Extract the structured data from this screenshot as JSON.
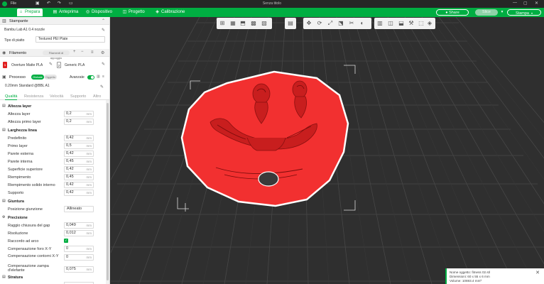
{
  "titlebar": {
    "menu_label": "File",
    "window_title": "Senza titolo"
  },
  "nav": {
    "tabs": [
      {
        "label": "Prepara",
        "icon": "home-icon"
      },
      {
        "label": "Anteprima",
        "icon": "preview-icon"
      },
      {
        "label": "Dispositivo",
        "icon": "device-icon"
      },
      {
        "label": "Progetto",
        "icon": "project-icon"
      },
      {
        "label": "Calibrazione",
        "icon": "calibration-icon"
      }
    ],
    "share_label": "Share",
    "slice_label": "Slice",
    "print_label": "Stampa"
  },
  "printer": {
    "section_label": "Stampante",
    "name": "Bambu Lab A1 0.4 nozzle",
    "plate_label": "Tipo di piatto",
    "plate_value": "Textured PEI Plate"
  },
  "filament": {
    "section_label": "Filamento",
    "support_button": "Filamenti di appoggio",
    "items": [
      {
        "index": "1",
        "name": "Overture Matte PLA",
        "color": "#e02020"
      },
      {
        "index": "2",
        "name": "Generic PLA",
        "color": "#ffffff"
      }
    ]
  },
  "process": {
    "section_label": "Processo",
    "global_label": "Globale",
    "object_label": "Oggetto",
    "advanced_label": "Avanzate",
    "preset": "0.20mm Standard @BBL A1"
  },
  "tabs": [
    "Qualità",
    "Resistenza",
    "Velocità",
    "Supporto",
    "Altro"
  ],
  "groups": [
    {
      "title": "Altezza layer",
      "rows": [
        {
          "label": "Altezza layer",
          "value": "0,2",
          "unit": "mm"
        },
        {
          "label": "Altezza primo layer",
          "value": "0,2",
          "unit": "mm"
        }
      ]
    },
    {
      "title": "Larghezza linea",
      "rows": [
        {
          "label": "Predefinito",
          "value": "0,42",
          "unit": "mm"
        },
        {
          "label": "Primo layer",
          "value": "0,5",
          "unit": "mm"
        },
        {
          "label": "Parete esterna",
          "value": "0,42",
          "unit": "mm"
        },
        {
          "label": "Parete interna",
          "value": "0,45",
          "unit": "mm"
        },
        {
          "label": "Superficie superiore",
          "value": "0,42",
          "unit": "mm"
        },
        {
          "label": "Riempimento",
          "value": "0,45",
          "unit": "mm"
        },
        {
          "label": "Riempimento solido interno",
          "value": "0,42",
          "unit": "mm"
        },
        {
          "label": "Supporto",
          "value": "0,42",
          "unit": "mm"
        }
      ]
    },
    {
      "title": "Giuntura",
      "rows": [
        {
          "label": "Posizione giunzione",
          "value": "Allineato",
          "unit": ""
        }
      ]
    },
    {
      "title": "Precisione",
      "rows": [
        {
          "label": "Raggio chiusura del gap",
          "value": "0,049",
          "unit": "mm"
        },
        {
          "label": "Risoluzione",
          "value": "0,012",
          "unit": "mm"
        },
        {
          "label": "Raccordo ad arco",
          "value": "",
          "unit": "",
          "checkbox": true
        },
        {
          "label": "Compensazione foro X-Y",
          "value": "0",
          "unit": "mm"
        },
        {
          "label": "Compensazione contorni X-Y",
          "value": "0",
          "unit": "mm"
        },
        {
          "label": "Compensazione zampa d'elefante",
          "value": "0,075",
          "unit": "mm"
        }
      ]
    },
    {
      "title": "Stratura",
      "rows": []
    }
  ],
  "object_info": {
    "name_line": "Nome oggetto: fitness 02.stl",
    "dimensions_line": "Dimensioni: 60 x 55 x 6 mm",
    "volume_line": "Volume: 10693.4 mm³"
  }
}
